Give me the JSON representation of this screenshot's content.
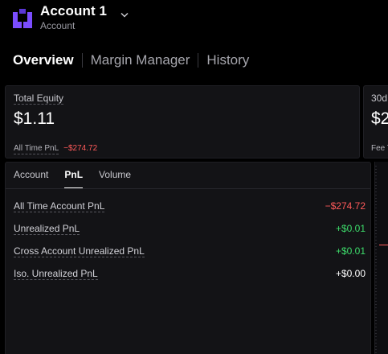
{
  "header": {
    "account_name": "Account 1",
    "account_sub": "Account",
    "logo_icon": "account-logo-icon",
    "dropdown_icon": "chevron-down-icon"
  },
  "tabs": [
    {
      "label": "Overview",
      "active": true
    },
    {
      "label": "Margin Manager",
      "active": false
    },
    {
      "label": "History",
      "active": false
    }
  ],
  "equity_card": {
    "label": "Total Equity",
    "value": "$1.11",
    "pnl_label": "All Time PnL",
    "pnl_value": "−$274.72"
  },
  "fee_card": {
    "label": "30d",
    "value": "$2",
    "foot": "Fee T"
  },
  "pnl_panel": {
    "subtabs": [
      {
        "label": "Account",
        "active": false
      },
      {
        "label": "PnL",
        "active": true
      },
      {
        "label": "Volume",
        "active": false
      }
    ],
    "rows": [
      {
        "label": "All Time Account PnL",
        "value": "−$274.72",
        "tone": "neg"
      },
      {
        "label": "Unrealized PnL",
        "value": "+$0.01",
        "tone": "pos"
      },
      {
        "label": "Cross Account Unrealized PnL",
        "value": "+$0.01",
        "tone": "pos"
      },
      {
        "label": "Iso. Unrealized PnL",
        "value": "+$0.00",
        "tone": "neu"
      }
    ]
  },
  "colors": {
    "background": "#000000",
    "card": "#131316",
    "negative": "#ff5a5a",
    "positive": "#3ddc6b",
    "logo": "#7b4dff"
  }
}
